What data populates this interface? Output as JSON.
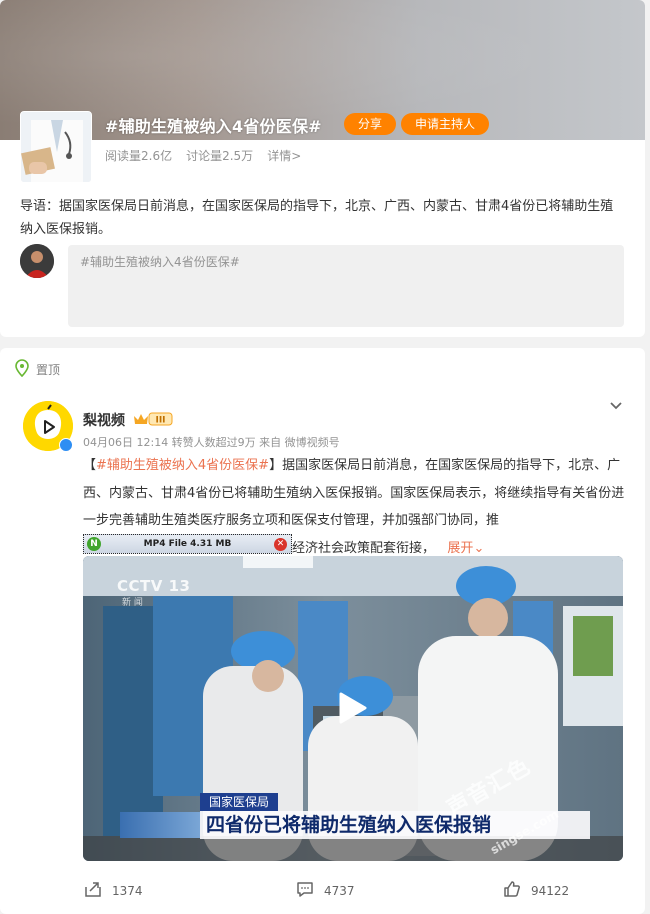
{
  "topic": {
    "title": "#辅助生殖被纳入4省份医保#",
    "share_label": "分享",
    "host_label": "申请主持人",
    "read_count": "阅读量2.6亿",
    "discuss_count": "讨论量2.5万",
    "detail_link": "详情>",
    "lead": "导语：据国家医保局日前消息，在国家医保局的指导下，北京、广西、内蒙古、甘肃4省份已将辅助生殖纳入医保报销。",
    "compose_placeholder": "#辅助生殖被纳入4省份医保#"
  },
  "post": {
    "pin_label": "置顶",
    "author": "梨视频",
    "level_badge": "III",
    "meta": "04月06日 12:14 转赞人数超过9万  来自 微博视频号",
    "hashtag": "#辅助生殖被纳入4省份医保#",
    "text_open": "【",
    "text_close": "】",
    "text": "据国家医保局日前消息，在国家医保局的指导下，北京、广西、内蒙古、甘肃4省份已将辅助生殖纳入医保报销。国家医保局表示，将继续指导有关省份进一步完善辅助生殖类医疗服务立项和医保支付管理，并加强部门协同，推",
    "text_tail": "经济社会政策配套衔接，",
    "expand_label": "展开",
    "mp4_label": "MP4 File 4.31 MB",
    "video": {
      "channel": "CCTV 13",
      "channel_sub": "新 闻",
      "caption_tag": "国家医保局",
      "caption": "四省份已将辅助生殖纳入医保报销",
      "watermark": "声音汇色",
      "watermark_sub": "singse.com"
    },
    "actions": {
      "share_count": "1374",
      "comment_count": "4737",
      "like_count": "94122"
    }
  },
  "colors": {
    "brand_orange": "#ff8200",
    "link_orange": "#eb7350",
    "verify_blue": "#2e8ef3"
  }
}
